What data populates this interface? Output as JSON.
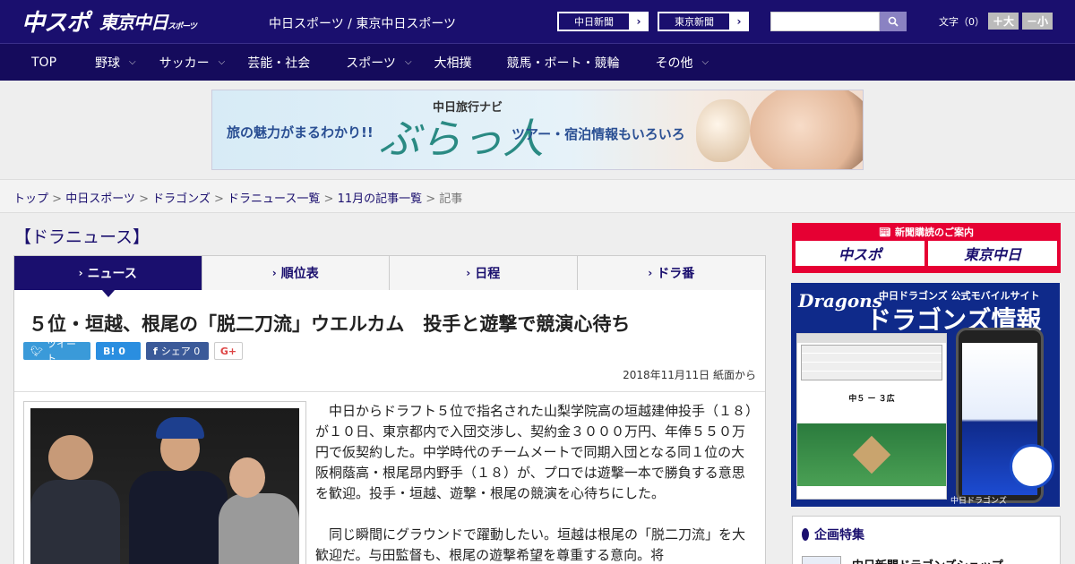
{
  "header": {
    "logo_main": "中スポ",
    "logo_sub": "東京中日",
    "logo_sub_small": "スポーツ",
    "site_name": "中日スポーツ / 東京中日スポーツ",
    "links": [
      "中日新聞",
      "東京新聞"
    ],
    "search_placeholder": "",
    "fontsize_label": "文字（0）",
    "fontsize_up": "＋大",
    "fontsize_down": "－小"
  },
  "nav": [
    {
      "label": "TOP",
      "has_menu": false
    },
    {
      "label": "野球",
      "has_menu": true
    },
    {
      "label": "サッカー",
      "has_menu": true
    },
    {
      "label": "芸能・社会",
      "has_menu": false
    },
    {
      "label": "スポーツ",
      "has_menu": true
    },
    {
      "label": "大相撲",
      "has_menu": false
    },
    {
      "label": "競馬・ボート・競輪",
      "has_menu": false
    },
    {
      "label": "その他",
      "has_menu": true
    }
  ],
  "banner": {
    "left": "旅の魅力がまるわかり!!",
    "brand": "中日旅行ナビ",
    "logo": "ぶらっ人",
    "right": "ツアー・宿泊情報もいろいろ"
  },
  "breadcrumb": {
    "items": [
      "トップ",
      "中日スポーツ",
      "ドラゴンズ",
      "ドラニュース一覧",
      "11月の記事一覧"
    ],
    "current": "記事",
    "sep": " > "
  },
  "section_title": "【ドラニュース】",
  "tabs": [
    {
      "label": "ニュース",
      "active": true
    },
    {
      "label": "順位表",
      "active": false
    },
    {
      "label": "日程",
      "active": false
    },
    {
      "label": "ドラ番",
      "active": false
    }
  ],
  "article": {
    "headline": "５位・垣越、根尾の「脱二刀流」ウエルカム　投手と遊撃で競演心待ち",
    "share": {
      "tweet": "ツイート",
      "hatena": "B! 0",
      "facebook": "シェア 0",
      "gplus": "G+"
    },
    "date": "2018年11月11日 紙面から",
    "paragraphs": [
      "中日からドラフト５位で指名された山梨学院高の垣越建伸投手（１８）が１０日、東京都内で入団交渉し、契約金３０００万円、年俸５５０万円で仮契約した。中学時代のチームメートで同期入団となる同１位の大阪桐蔭高・根尾昂内野手（１８）が、プロでは遊撃一本で勝負する意思を歓迎。投手・垣越、遊撃・根尾の競演を心待ちにした。",
      "同じ瞬間にグラウンドで躍動したい。垣越は根尾の「脱二刀流」を大歓迎だ。与田監督も、根尾の遊撃希望を尊重する意向。将"
    ]
  },
  "sidebar": {
    "subscribe_header": "新聞購読のご案内",
    "subscribe_logos": [
      "中スポ",
      "東京中日"
    ],
    "dragons": {
      "title_en": "Dragons",
      "title_small": "中日ドラゴンズ 公式モバイルサイト",
      "title_big": "ドラゴンズ情報",
      "score": "中５ ー ３広",
      "footer": "中日ドラゴンズ"
    },
    "feature": {
      "header": "企画特集",
      "item": "中日新聞ドラゴンズショップ"
    }
  },
  "colors": {
    "brand": "#1a0f6e",
    "nav": "#150b5c",
    "subscribe": "#e60033"
  }
}
